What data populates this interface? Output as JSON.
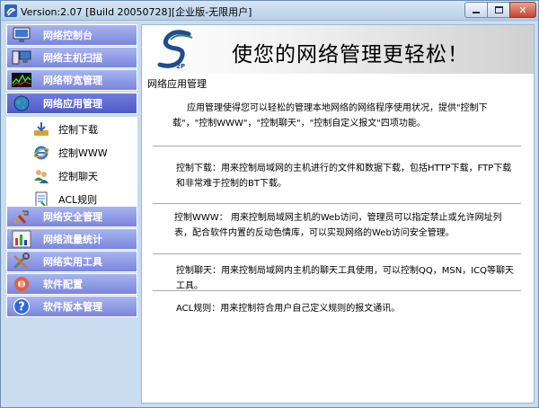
{
  "window": {
    "title": "Version:2.07 [Build 20050728][企业版-无限用户]"
  },
  "sidebar": {
    "items": [
      {
        "label": "网络控制台",
        "icon": "monitor-icon",
        "active": false
      },
      {
        "label": "网络主机扫描",
        "icon": "computer-icon",
        "active": false
      },
      {
        "label": "网络带宽管理",
        "icon": "bandwidth-chart-icon",
        "active": false
      },
      {
        "label": "网络应用管理",
        "icon": "globe-icon",
        "active": true
      },
      {
        "label": "网络安全管理",
        "icon": "tools-icon",
        "active": false
      },
      {
        "label": "网络流量统计",
        "icon": "bar-chart-icon",
        "active": false
      },
      {
        "label": "网络实用工具",
        "icon": "wrench-icon",
        "active": false
      },
      {
        "label": "软件配置",
        "icon": "config-icon",
        "active": false
      },
      {
        "label": "软件版本管理",
        "icon": "help-icon",
        "active": false
      }
    ],
    "submenu": [
      {
        "label": "控制下载",
        "icon": "download-icon"
      },
      {
        "label": "控制WWW",
        "icon": "ie-icon"
      },
      {
        "label": "控制聊天",
        "icon": "chat-users-icon"
      },
      {
        "label": "ACL规则",
        "icon": "document-icon"
      }
    ]
  },
  "banner": {
    "title": "使您的网络管理更轻松！",
    "logo": "2P"
  },
  "content": {
    "section_title": "网络应用管理",
    "intro": "应用管理使得您可以轻松的管理本地网络的网络程序使用状况，提供\"控制下载\"，\"控制WWW\"，\"控制聊天\"，\"控制自定义报文\"四项功能。",
    "download_desc": "控制下载：用来控制局域网的主机进行的文件和数据下载，包括HTTP下载，FTP下载和非常难于控制的BT下载。",
    "www_desc": "控制WWW：  用来控制局域网主机的Web访问，管理员可以指定禁止或允许网址列表，配合软件内置的反动色情库，可以实现网络的Web访问安全管理。",
    "chat_desc": "控制聊天：用来控制局域网内主机的聊天工具使用，可以控制QQ，MSN，ICQ等聊天工具。",
    "acl_desc": "ACL规则：用来控制符合用户自己定义规则的报文通讯。"
  },
  "colors": {
    "nav_bg": "#8f9ae6",
    "nav_active_bg": "#5a66cf",
    "frame_bg": "#c9dcf0",
    "close_button": "#c7442f"
  }
}
